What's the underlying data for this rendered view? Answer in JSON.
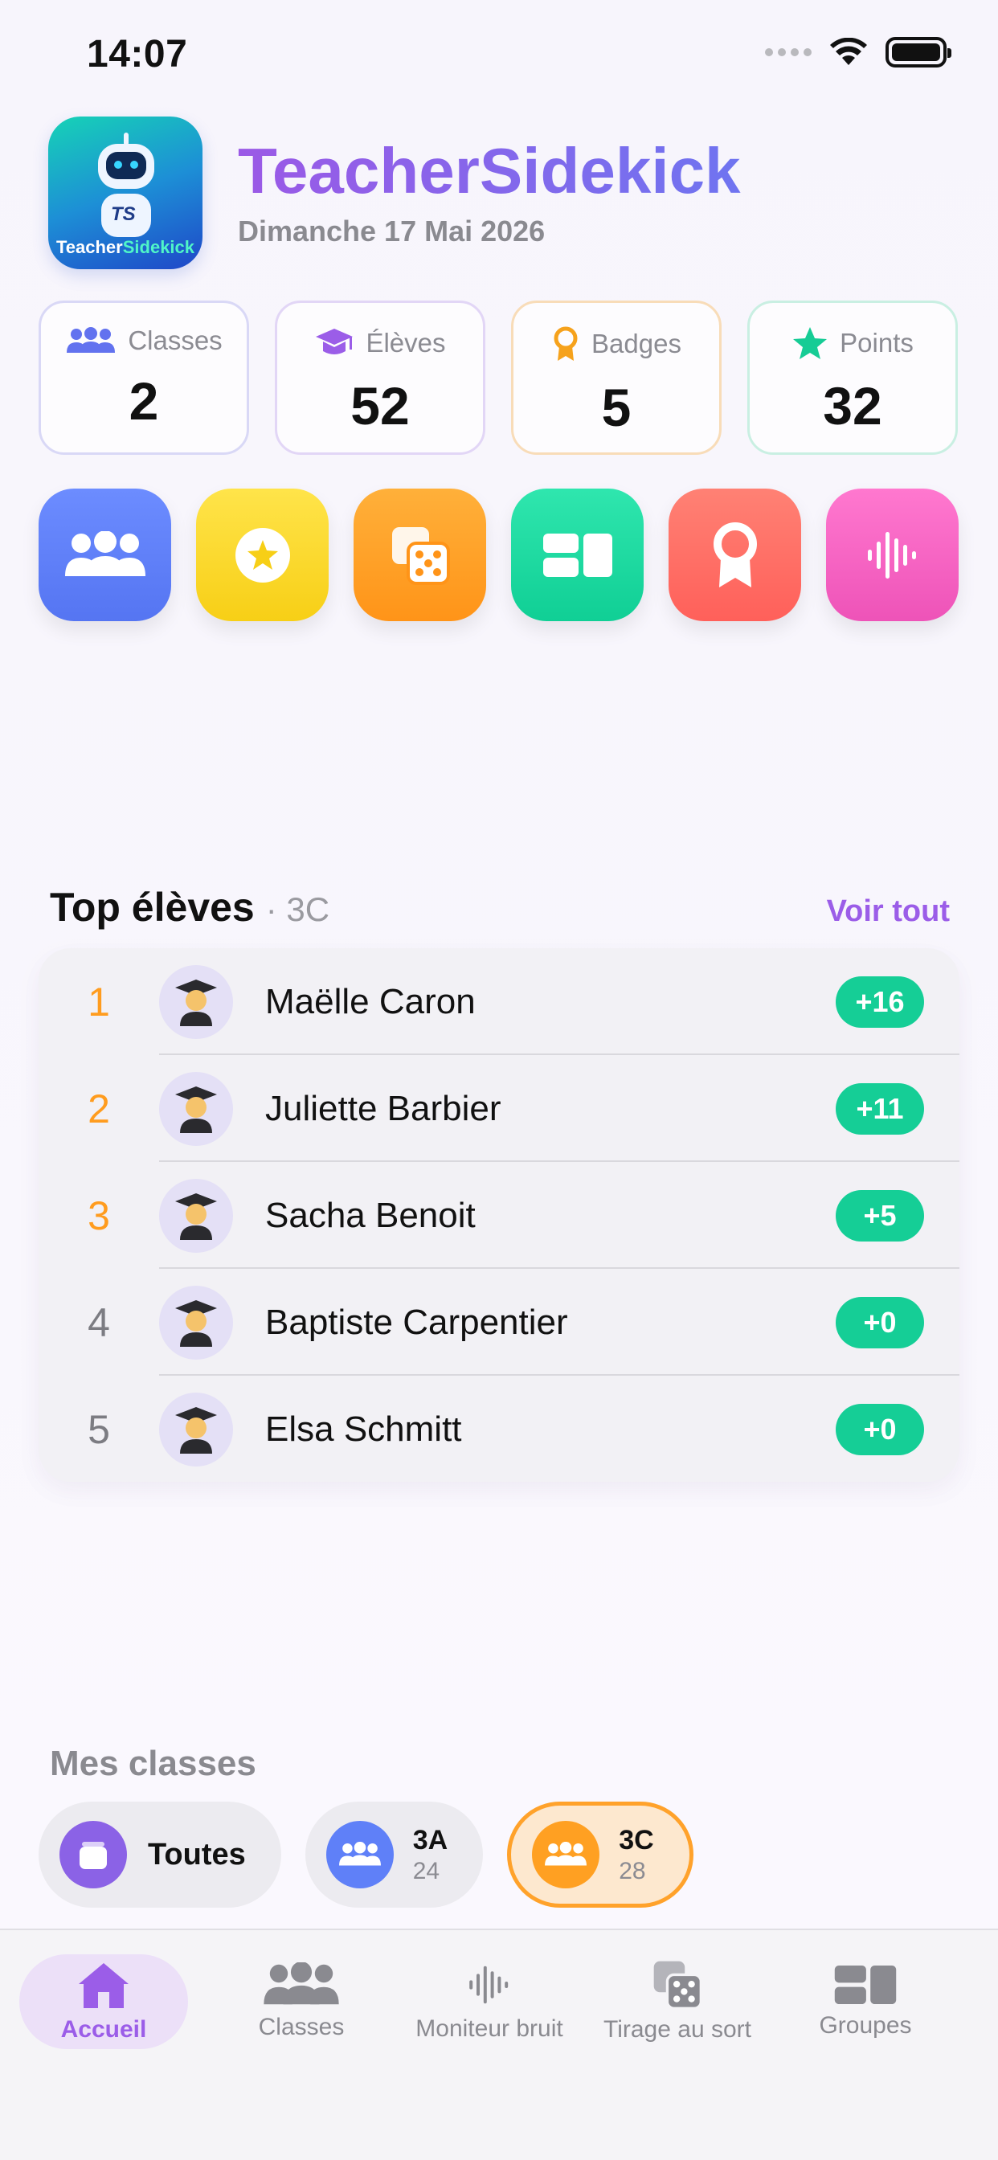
{
  "status_bar": {
    "time": "14:07"
  },
  "header": {
    "logo_text_a": "Teacher",
    "logo_text_b": "Sidekick",
    "logo_badge": "TS",
    "title": "TeacherSidekick",
    "date": "Dimanche 17 Mai 2026"
  },
  "stats": [
    {
      "label": "Classes",
      "value": "2",
      "icon": "people-icon",
      "color": "#6272ef"
    },
    {
      "label": "Élèves",
      "value": "52",
      "icon": "graduation-cap-icon",
      "color": "#9b5de8"
    },
    {
      "label": "Badges",
      "value": "5",
      "icon": "badge-icon",
      "color": "#f6a21c"
    },
    {
      "label": "Points",
      "value": "32",
      "icon": "star-icon",
      "color": "#16cc95"
    }
  ],
  "quick_actions": [
    {
      "icon": "people-icon",
      "color": "#5f80f8"
    },
    {
      "icon": "star-coin-icon",
      "color": "#f9d624"
    },
    {
      "icon": "dice-icon",
      "color": "#ffa022"
    },
    {
      "icon": "groups-icon",
      "color": "#16d89e"
    },
    {
      "icon": "award-icon",
      "color": "#ff6b63"
    },
    {
      "icon": "sound-wave-icon",
      "color": "#f262c2"
    }
  ],
  "top_students": {
    "title": "Top élèves",
    "subtitle": "· 3C",
    "see_all": "Voir tout",
    "rows": [
      {
        "rank": "1",
        "name": "Maëlle Caron",
        "score": "+16"
      },
      {
        "rank": "2",
        "name": "Juliette Barbier",
        "score": "+11"
      },
      {
        "rank": "3",
        "name": "Sacha Benoit",
        "score": "+5"
      },
      {
        "rank": "4",
        "name": "Baptiste Carpentier",
        "score": "+0"
      },
      {
        "rank": "5",
        "name": "Elsa Schmitt",
        "score": "+0"
      }
    ]
  },
  "my_classes": {
    "title": "Mes classes",
    "chips": [
      {
        "label": "Toutes"
      },
      {
        "name": "3A",
        "count": "24"
      },
      {
        "name": "3C",
        "count": "28"
      }
    ]
  },
  "tab_bar": [
    {
      "label": "Accueil",
      "icon": "home-icon"
    },
    {
      "label": "Classes",
      "icon": "people-icon"
    },
    {
      "label": "Moniteur bruit",
      "icon": "sound-wave-icon"
    },
    {
      "label": "Tirage au sort",
      "icon": "dice-icon"
    },
    {
      "label": "Groupes",
      "icon": "groups-icon"
    }
  ]
}
